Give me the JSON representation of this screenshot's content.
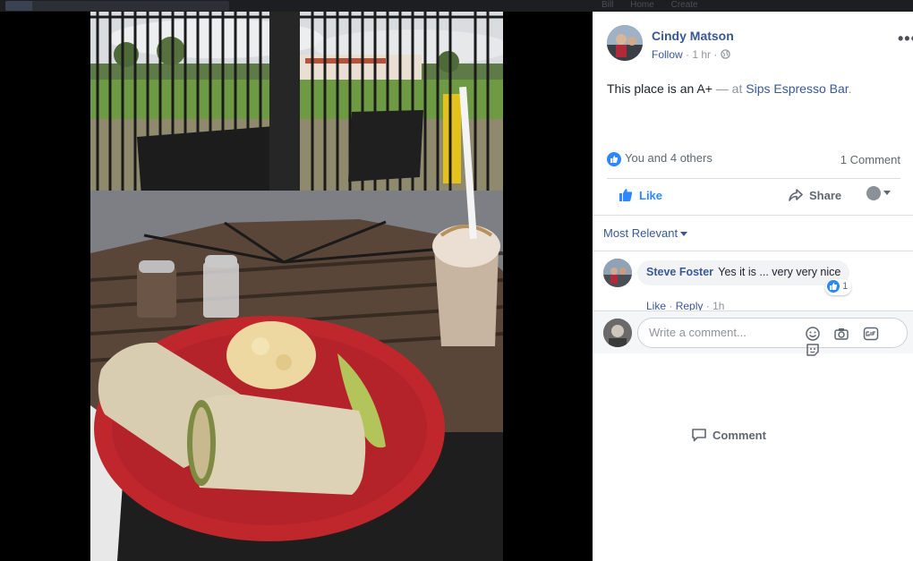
{
  "topbar": {
    "nav": [
      "Bill",
      "Home",
      "Create"
    ]
  },
  "post": {
    "author": "Cindy Matson",
    "follow": "Follow",
    "time": "1 hr",
    "text_main": "This place is an A+",
    "text_at": " — at ",
    "place": "Sips Espresso Bar",
    "text_end": "."
  },
  "reactions": {
    "summary": "You and 4 others",
    "comments_count": "1 Comment"
  },
  "actions": {
    "like": "Like",
    "comment": "Comment",
    "share": "Share"
  },
  "sort": {
    "label": "Most Relevant"
  },
  "comment": {
    "name": "Steve Foster",
    "text": "Yes it is ... very very nice",
    "likes": "1",
    "like_link": "Like",
    "reply_link": "Reply",
    "time": "1h"
  },
  "composer": {
    "placeholder": "Write a comment..."
  },
  "colors": {
    "link": "#385898",
    "like_blue": "#2d88ff",
    "plate_red": "#c0272d"
  }
}
